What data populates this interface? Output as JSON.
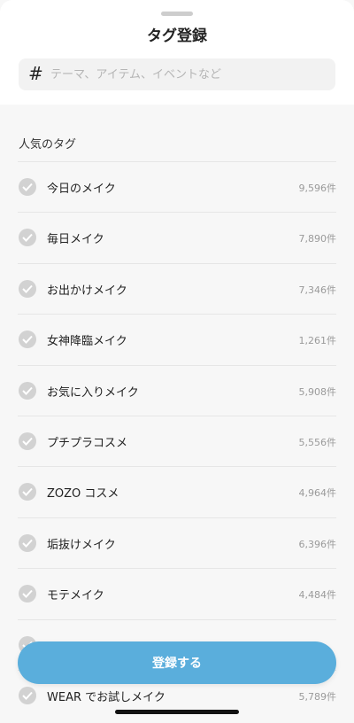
{
  "header": {
    "title": "タグ登録"
  },
  "search": {
    "hash_symbol": "#",
    "placeholder": "テーマ、アイテム、イベントなど"
  },
  "section": {
    "label": "人気のタグ"
  },
  "tags": [
    {
      "label": "今日のメイク",
      "count": "9,596件"
    },
    {
      "label": "毎日メイク",
      "count": "7,890件"
    },
    {
      "label": "お出かけメイク",
      "count": "7,346件"
    },
    {
      "label": "女神降臨メイク",
      "count": "1,261件"
    },
    {
      "label": "お気に入りメイク",
      "count": "5,908件"
    },
    {
      "label": "プチプラコスメ",
      "count": "5,556件"
    },
    {
      "label": "ZOZO コスメ",
      "count": "4,964件"
    },
    {
      "label": "垢抜けメイク",
      "count": "6,396件"
    },
    {
      "label": "モテメイク",
      "count": "4,484件"
    },
    {
      "label": "",
      "count": ""
    },
    {
      "label": "WEAR でお試しメイク",
      "count": "5,789件"
    }
  ],
  "footer": {
    "submit_label": "登録する"
  },
  "colors": {
    "accent": "#5aaedc",
    "check_bg": "#d2d2d2"
  }
}
